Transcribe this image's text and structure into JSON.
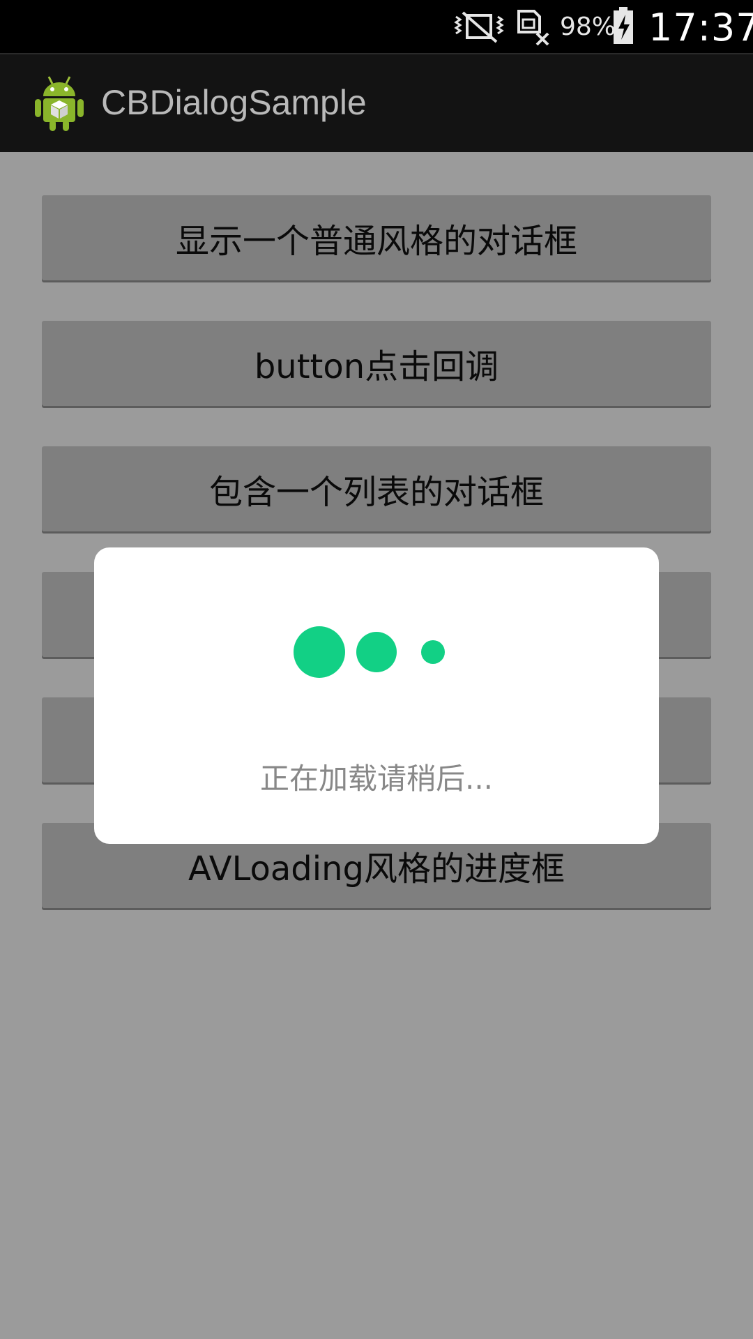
{
  "status_bar": {
    "battery_percent": "98%",
    "time": "17:37",
    "icons": [
      "mute-vibrate-icon",
      "no-sim-icon",
      "battery-charging-icon"
    ]
  },
  "action_bar": {
    "title": "CBDialogSample",
    "icon": "android-app-icon"
  },
  "buttons": [
    {
      "label": "显示一个普通风格的对话框"
    },
    {
      "label": "button点击回调"
    },
    {
      "label": "包含一个列表的对话框"
    },
    {
      "label": ""
    },
    {
      "label": ""
    },
    {
      "label": "AVLoading风格的进度框"
    }
  ],
  "dialog": {
    "message": "正在加载请稍后...",
    "indicator": "three-dot-loading-indicator",
    "accent_color": "#12d085"
  },
  "colors": {
    "status_bar": "#000000",
    "action_bar": "#131313",
    "background_dimmed": "#9b9b9b",
    "button_dimmed": "#7f7f7f",
    "dialog": "#ffffff"
  }
}
